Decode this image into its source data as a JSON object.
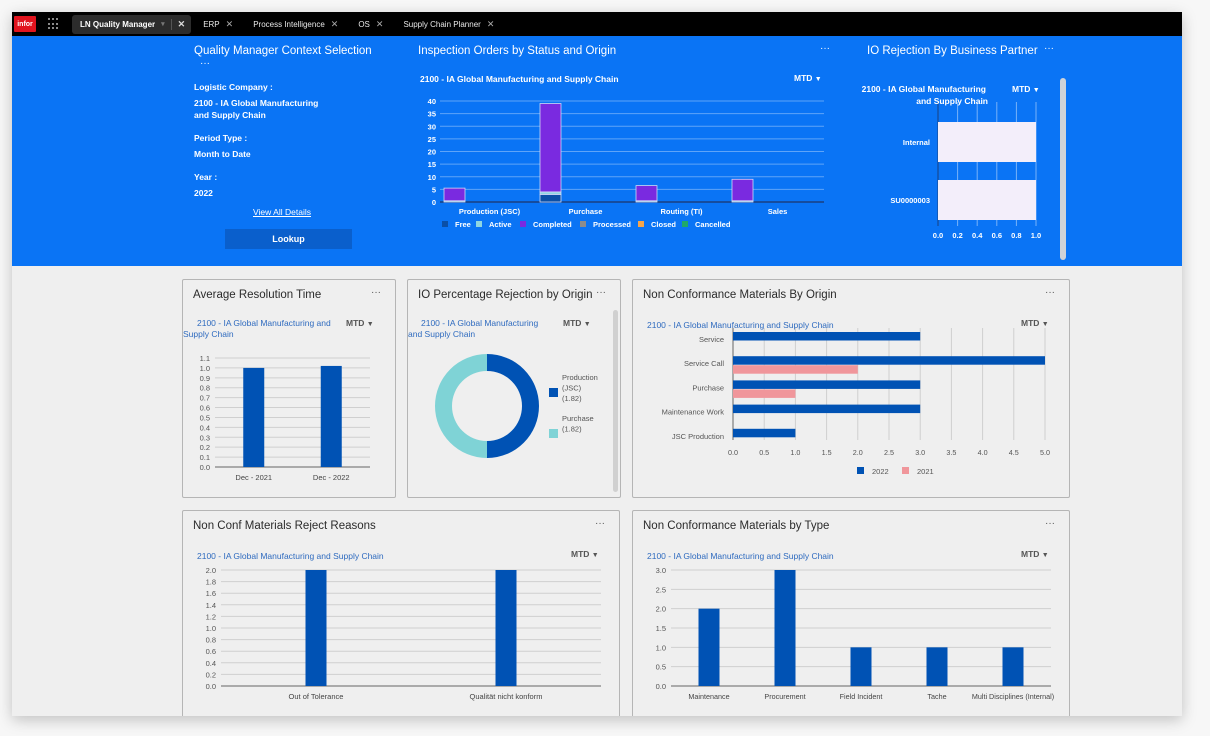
{
  "tabbar": {
    "logo": "infor",
    "tabs": [
      {
        "label": "LN Quality Manager",
        "active": true
      },
      {
        "label": "ERP"
      },
      {
        "label": "Process Intelligence"
      },
      {
        "label": "OS"
      },
      {
        "label": "Supply Chain Planner"
      }
    ]
  },
  "context": {
    "title": "Quality Manager Context Selection",
    "menu": "···",
    "logistic_company_label": "Logistic Company :",
    "logistic_company_line1": "2100 - IA Global Manufacturing",
    "logistic_company_line2": "and Supply Chain",
    "period_type_label": "Period Type :",
    "period_type_value": "Month to Date",
    "year_label": "Year :",
    "year_value": "2022",
    "view_all_link": "View All Details",
    "lookup_button": "Lookup"
  },
  "colors": {
    "header_blue": "#0a74f5",
    "bar_blue": "#0052b4",
    "bar_pink": "#f0969b",
    "teal": "#7fd3d6"
  },
  "chart_data": [
    {
      "id": "inspection_orders",
      "type": "bar",
      "stacked": true,
      "title": "Inspection Orders by Status and Origin",
      "subtitle": "2100 - IA Global Manufacturing and Supply Chain",
      "period": "MTD",
      "categories": [
        "Production (JSC)",
        "Purchase",
        "Routing (TI)",
        "Sales"
      ],
      "series": [
        {
          "name": "Free",
          "color": "#0a4fa6",
          "values": [
            0,
            3,
            0,
            0
          ]
        },
        {
          "name": "Active",
          "color": "#8fd6e0",
          "values": [
            0.5,
            1,
            0.5,
            0.5
          ]
        },
        {
          "name": "Completed",
          "color": "#7a2ae0",
          "values": [
            5,
            35,
            6,
            8.5
          ]
        },
        {
          "name": "Processed",
          "color": "#8c8c8c",
          "values": [
            0,
            0,
            0,
            0
          ]
        },
        {
          "name": "Closed",
          "color": "#f5a54a",
          "values": [
            0,
            0,
            0,
            0
          ]
        },
        {
          "name": "Cancelled",
          "color": "#1fa86a",
          "values": [
            0,
            0,
            0,
            0
          ]
        }
      ],
      "yticks": [
        0,
        5,
        10,
        15,
        20,
        25,
        30,
        35,
        40
      ],
      "ylim": [
        0,
        40
      ],
      "legend": "bottom",
      "grid": true
    },
    {
      "id": "io_rejection_partner",
      "type": "bar",
      "orientation": "horizontal",
      "title": "IO Rejection By Business Partner",
      "subtitle_line1": "2100 - IA Global Manufacturing",
      "subtitle_line2": "and Supply Chain",
      "period": "MTD",
      "categories": [
        "Internal",
        "SU0000003"
      ],
      "values": [
        1.0,
        1.0
      ],
      "xticks": [
        "0.0",
        "0.2",
        "0.4",
        "0.6",
        "0.8",
        "1.0"
      ],
      "xlim": [
        0,
        1.0
      ],
      "grid": true
    },
    {
      "id": "avg_resolution",
      "type": "bar",
      "title": "Average Resolution Time",
      "subtitle_line1": "2100 - IA Global Manufacturing and",
      "subtitle_line2": "Supply Chain",
      "period": "MTD",
      "categories": [
        "Dec - 2021",
        "Dec - 2022"
      ],
      "values": [
        1.0,
        1.02
      ],
      "yticks": [
        "0.0",
        "0.1",
        "0.2",
        "0.3",
        "0.4",
        "0.5",
        "0.6",
        "0.7",
        "0.8",
        "0.9",
        "1.0",
        "1.1"
      ],
      "ylim": [
        0,
        1.1
      ],
      "grid": true
    },
    {
      "id": "io_pct_rejection",
      "type": "pie",
      "donut": true,
      "title": "IO Percentage Rejection by Origin",
      "subtitle_line1": "2100 - IA Global Manufacturing",
      "subtitle_line2": "and Supply Chain",
      "period": "MTD",
      "slices": [
        {
          "label_lines": [
            "Production",
            "(JSC)",
            "(1.82)"
          ],
          "name": "Production (JSC)",
          "value": 1.82,
          "color": "#0052b4"
        },
        {
          "label_lines": [
            "Purchase",
            "(1.82)"
          ],
          "name": "Purchase",
          "value": 1.82,
          "color": "#7fd3d6"
        }
      ],
      "legend": "right"
    },
    {
      "id": "ncm_by_origin",
      "type": "bar",
      "orientation": "horizontal",
      "title": "Non Conformance Materials By Origin",
      "subtitle": "2100 - IA Global Manufacturing and Supply Chain",
      "period": "MTD",
      "categories": [
        "Service",
        "Service Call",
        "Purchase",
        "Maintenance Work",
        "JSC Production"
      ],
      "series": [
        {
          "name": "2022",
          "color": "#0052b4",
          "values": [
            3,
            5,
            3,
            3,
            1
          ]
        },
        {
          "name": "2021",
          "color": "#f0969b",
          "values": [
            0,
            2,
            1,
            0,
            0
          ]
        }
      ],
      "xticks": [
        "0.0",
        "0.5",
        "1.0",
        "1.5",
        "2.0",
        "2.5",
        "3.0",
        "3.5",
        "4.0",
        "4.5",
        "5.0"
      ],
      "xlim": [
        0,
        5
      ],
      "legend": "bottom",
      "grid": true
    },
    {
      "id": "ncm_reject_reasons",
      "type": "bar",
      "title": "Non Conf Materials Reject Reasons",
      "subtitle": "2100 - IA Global Manufacturing and Supply Chain",
      "period": "MTD",
      "categories": [
        "Out of Tolerance",
        "Qualität nicht konform"
      ],
      "values": [
        2.0,
        2.0
      ],
      "yticks": [
        "0.0",
        "0.2",
        "0.4",
        "0.6",
        "0.8",
        "1.0",
        "1.2",
        "1.4",
        "1.6",
        "1.8",
        "2.0"
      ],
      "ylim": [
        0,
        2.0
      ],
      "grid": true
    },
    {
      "id": "ncm_by_type",
      "type": "bar",
      "title": "Non Conformance Materials by Type",
      "subtitle": "2100 - IA Global Manufacturing and Supply Chain",
      "period": "MTD",
      "categories": [
        "Maintenance",
        "Procurement",
        "Field Incident",
        "Tache",
        "Multi Disciplines (Internal)"
      ],
      "values": [
        2,
        3,
        1,
        1,
        1
      ],
      "yticks": [
        "0.0",
        "0.5",
        "1.0",
        "1.5",
        "2.0",
        "2.5",
        "3.0"
      ],
      "ylim": [
        0,
        3.0
      ],
      "grid": true
    }
  ]
}
